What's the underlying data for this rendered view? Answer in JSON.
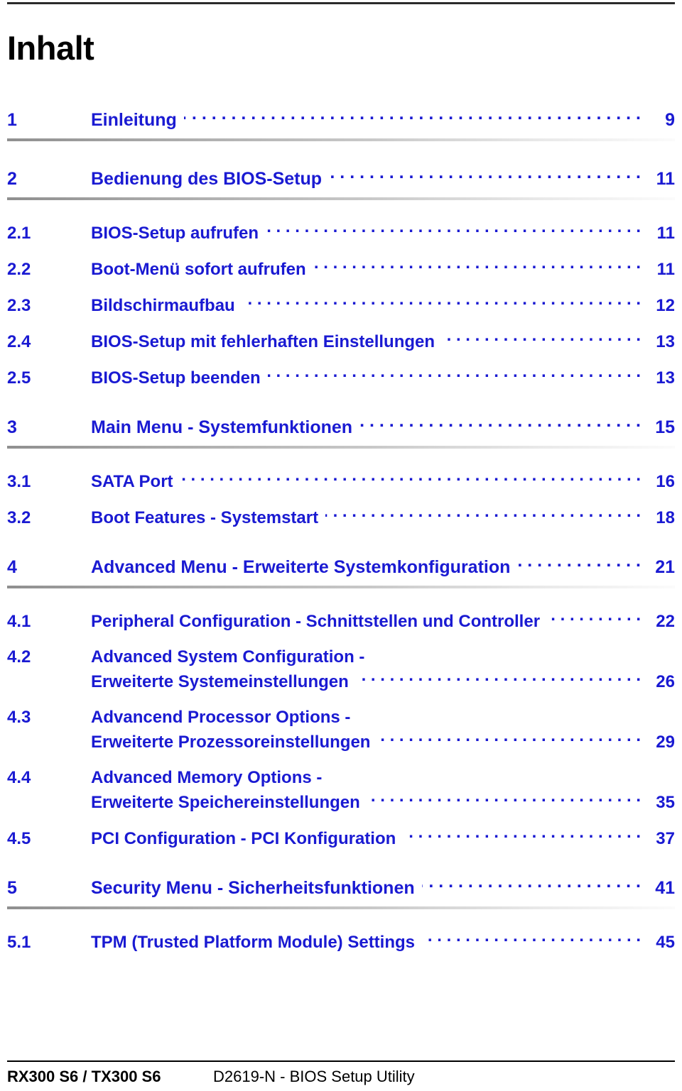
{
  "document": {
    "title": "Inhalt",
    "accent_color": "#1a1ad2",
    "text_color": "#000000"
  },
  "toc": {
    "groups": [
      {
        "chapter": {
          "num": "1",
          "label": "Einleitung",
          "page": "9"
        },
        "sections": []
      },
      {
        "chapter": {
          "num": "2",
          "label": "Bedienung des BIOS-Setup",
          "page": "11"
        },
        "sections": [
          {
            "num": "2.1",
            "label": "BIOS-Setup aufrufen",
            "page": "11"
          },
          {
            "num": "2.2",
            "label": "Boot-Menü sofort aufrufen",
            "page": "11"
          },
          {
            "num": "2.3",
            "label": "Bildschirmaufbau",
            "page": "12"
          },
          {
            "num": "2.4",
            "label": "BIOS-Setup mit fehlerhaften Einstellungen",
            "page": "13"
          },
          {
            "num": "2.5",
            "label": "BIOS-Setup beenden",
            "page": "13"
          }
        ]
      },
      {
        "chapter": {
          "num": "3",
          "label": "Main Menu - Systemfunktionen",
          "page": "15"
        },
        "sections": [
          {
            "num": "3.1",
            "label": "SATA Port",
            "page": "16"
          },
          {
            "num": "3.2",
            "label": "Boot Features - Systemstart",
            "page": "18"
          }
        ]
      },
      {
        "chapter": {
          "num": "4",
          "label": "Advanced Menu - Erweiterte Systemkonfiguration",
          "page": "21"
        },
        "sections": [
          {
            "num": "4.1",
            "label": "Peripheral Configuration - Schnittstellen und Controller",
            "page": "22"
          },
          {
            "num": "4.2",
            "label": "Advanced System Configuration -",
            "label2": "Erweiterte Systemeinstellungen",
            "page": "26"
          },
          {
            "num": "4.3",
            "label": "Advancend Processor Options -",
            "label2": "Erweiterte Prozessoreinstellungen",
            "page": "29"
          },
          {
            "num": "4.4",
            "label": "Advanced Memory Options -",
            "label2": "Erweiterte Speichereinstellungen",
            "page": "35"
          },
          {
            "num": "4.5",
            "label": "PCI Configuration - PCI Konfiguration",
            "page": "37"
          }
        ]
      },
      {
        "chapter": {
          "num": "5",
          "label": "Security Menu - Sicherheitsfunktionen",
          "page": "41"
        },
        "sections": [
          {
            "num": "5.1",
            "label": "TPM (Trusted Platform Module) Settings",
            "page": "45"
          }
        ]
      }
    ]
  },
  "footer": {
    "model": "RX300 S6 / TX300 S6",
    "subtitle": "D2619-N - BIOS Setup Utility"
  }
}
